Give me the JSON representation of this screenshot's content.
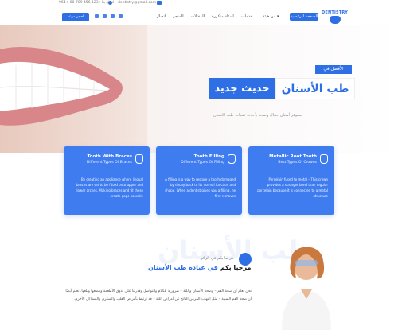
{
  "topbar": {
    "email": "dentistry@gmail.com",
    "phone": "اتصل بنا : 123 456 789 00 +964"
  },
  "brand": {
    "logo_text": "DENTISTRY"
  },
  "nav": {
    "active": "الصفحة الرئيسية",
    "dropdown": "من هيئة ▾",
    "items": [
      "خدمات",
      "أسئلة متكررة",
      "المقالات",
      "المتجر",
      "اتصال"
    ],
    "book_button": "احجز موعد"
  },
  "hero": {
    "tag": "الأفضل في",
    "title_part1": "طب الأسنان",
    "title_part2": "حديث جديد",
    "subtitle": "سيوفر أسنان جمال وصحة بأحدث تقنيات طب الاسنان"
  },
  "cards": [
    {
      "title": "Metallic Root Tooth",
      "subtitle": "Best Types Of Crowns",
      "body": "Porcelain fused to metal – This crown provides a stronger bond than regular porcelain because it is connected to a metal structure."
    },
    {
      "title": "Tooth Filling",
      "subtitle": "Different Types Of Filling",
      "body": "A filling is a way to restore a tooth damaged by decay back to its normal function and shape. When a dentist gives you a filling, he first removes"
    },
    {
      "title": "Tooth With Braces",
      "subtitle": "Different Types Of Braces",
      "body": "By creating an appliance where lingual braces are set to be fitted onto upper and lower arches. Making braces and fit these create gaps possible."
    }
  ],
  "welcome": {
    "bg_word": "طب الأسنان",
    "small_label": "مرحبا بكم في الزائر",
    "title_prefix": "مرحبا بكم",
    "title_highlight": "في عيادة طب الأسنان",
    "body": "نحن نعلم أن صحة الفم – وصحة الأسنان واللثة – ضرورية للكلام والتواصل وقدرتنا على تذوق الأطعمة ومضغها وبلعها. نعلم أيضًا أن صحة الفم السيئة – مثل التهاب المزمن الناتج عن أمراض اللثة – قد ترتبط بأمراض القلب والسكري والمشاكل الأخرى."
  },
  "colors": {
    "accent": "#2f6fe6",
    "card": "#3f7cf0"
  }
}
